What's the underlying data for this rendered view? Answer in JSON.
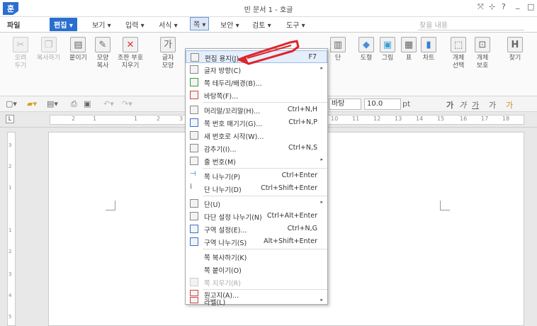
{
  "app": {
    "logo": "훈",
    "title": "빈 문서 1 - 호글"
  },
  "window_controls": {
    "fullscreen": "⤧",
    "pin": "⊹",
    "help": "?",
    "minimize": "_",
    "maximize": "□"
  },
  "menu": {
    "items": [
      "파일",
      "편집",
      "보기",
      "입력",
      "서식",
      "쪽",
      "보안",
      "검토",
      "도구"
    ],
    "search_placeholder": "찾을 내용"
  },
  "ribbon": {
    "buttons": [
      {
        "label": "오려\n두기",
        "icon": "scissors-icon",
        "glyph": "✂"
      },
      {
        "label": "복사하기",
        "icon": "copy-icon",
        "glyph": "❐"
      },
      {
        "label": "붙이기",
        "icon": "paste-icon",
        "glyph": "📋"
      },
      {
        "label": "모양\n복사",
        "icon": "format-copy-icon",
        "glyph": "🖌"
      },
      {
        "label": "조판 부호\n지우기",
        "icon": "clear-codes-icon",
        "glyph": "✕"
      },
      {
        "label": "글자\n모양",
        "icon": "char-shape-icon",
        "glyph": "가"
      },
      {
        "label": "단",
        "icon": "column-icon",
        "glyph": "▥"
      },
      {
        "label": "도형",
        "icon": "shape-icon",
        "glyph": "◆"
      },
      {
        "label": "그림",
        "icon": "picture-icon",
        "glyph": "▣"
      },
      {
        "label": "표",
        "icon": "table-icon",
        "glyph": "▦"
      },
      {
        "label": "차트",
        "icon": "chart-icon",
        "glyph": "▮"
      },
      {
        "label": "개체\n선택",
        "icon": "object-select-icon",
        "glyph": "⬚"
      },
      {
        "label": "개체\n보호",
        "icon": "object-protect-icon",
        "glyph": "🔒"
      },
      {
        "label": "찾기",
        "icon": "find-icon",
        "glyph": "H"
      }
    ]
  },
  "toolbar2": {
    "style_value": "바탕",
    "size_value": "10.0",
    "size_unit": "pt",
    "format_buttons": [
      "가",
      "가",
      "가",
      "가",
      "가"
    ]
  },
  "ruler": {
    "numbers": [
      "2",
      "1",
      "1",
      "2",
      "3",
      "10",
      "11",
      "12",
      "13",
      "14",
      "15",
      "16",
      "17",
      "18"
    ]
  },
  "vruler": {
    "numbers": [
      "3",
      "2",
      "1",
      "1",
      "2",
      "3",
      "4",
      "5"
    ]
  },
  "page_menu": {
    "items": [
      {
        "label": "편집 용지(J)...",
        "shortcut": "F7",
        "icon": "page-setup-icon",
        "highlight": true
      },
      {
        "label": "글자 방향(C)",
        "shortcut": "",
        "icon": "text-direction-icon",
        "submenu": true
      },
      {
        "label": "쪽 테두리/배경(B)...",
        "shortcut": "",
        "icon": "page-border-icon"
      },
      {
        "label": "바탕쪽(F)...",
        "shortcut": "",
        "icon": "master-page-icon"
      },
      {
        "label": "머리말/꼬리말(H)...",
        "shortcut": "Ctrl+N,H",
        "icon": "header-footer-icon"
      },
      {
        "label": "쪽 번호 매기기(G)...",
        "shortcut": "Ctrl+N,P",
        "icon": "page-number-icon"
      },
      {
        "label": "새 번호로 시작(W)...",
        "shortcut": "",
        "icon": "new-number-icon"
      },
      {
        "label": "감추기(I)...",
        "shortcut": "Ctrl+N,S",
        "icon": "hide-icon"
      },
      {
        "label": "줄 번호(M)",
        "shortcut": "",
        "icon": "line-number-icon",
        "submenu": true
      },
      {
        "label": "쪽 나누기(P)",
        "shortcut": "Ctrl+Enter",
        "icon": "page-break-icon"
      },
      {
        "label": "단 나누기(D)",
        "shortcut": "Ctrl+Shift+Enter",
        "icon": "column-break-icon"
      },
      {
        "label": "단(U)",
        "shortcut": "",
        "icon": "columns-icon",
        "submenu": true
      },
      {
        "label": "다단 설정 나누기(N)",
        "shortcut": "Ctrl+Alt+Enter",
        "icon": "multi-column-break-icon"
      },
      {
        "label": "구역 설정(E)...",
        "shortcut": "Ctrl+N,G",
        "icon": "section-setup-icon"
      },
      {
        "label": "구역 나누기(S)",
        "shortcut": "Alt+Shift+Enter",
        "icon": "section-break-icon"
      },
      {
        "label": "쪽 복사하기(K)",
        "shortcut": "",
        "icon": ""
      },
      {
        "label": "쪽 붙이기(O)",
        "shortcut": "",
        "icon": ""
      },
      {
        "label": "쪽 지우기(R)",
        "shortcut": "",
        "icon": "page-delete-icon",
        "disabled": true
      },
      {
        "label": "원고지(A)...",
        "shortcut": "",
        "icon": "manuscript-icon"
      },
      {
        "label": "라벨(L)",
        "shortcut": "",
        "icon": "label-icon",
        "submenu": true
      }
    ]
  },
  "colors": {
    "accent": "#2a6fd0",
    "pencil": "#e0242b"
  }
}
